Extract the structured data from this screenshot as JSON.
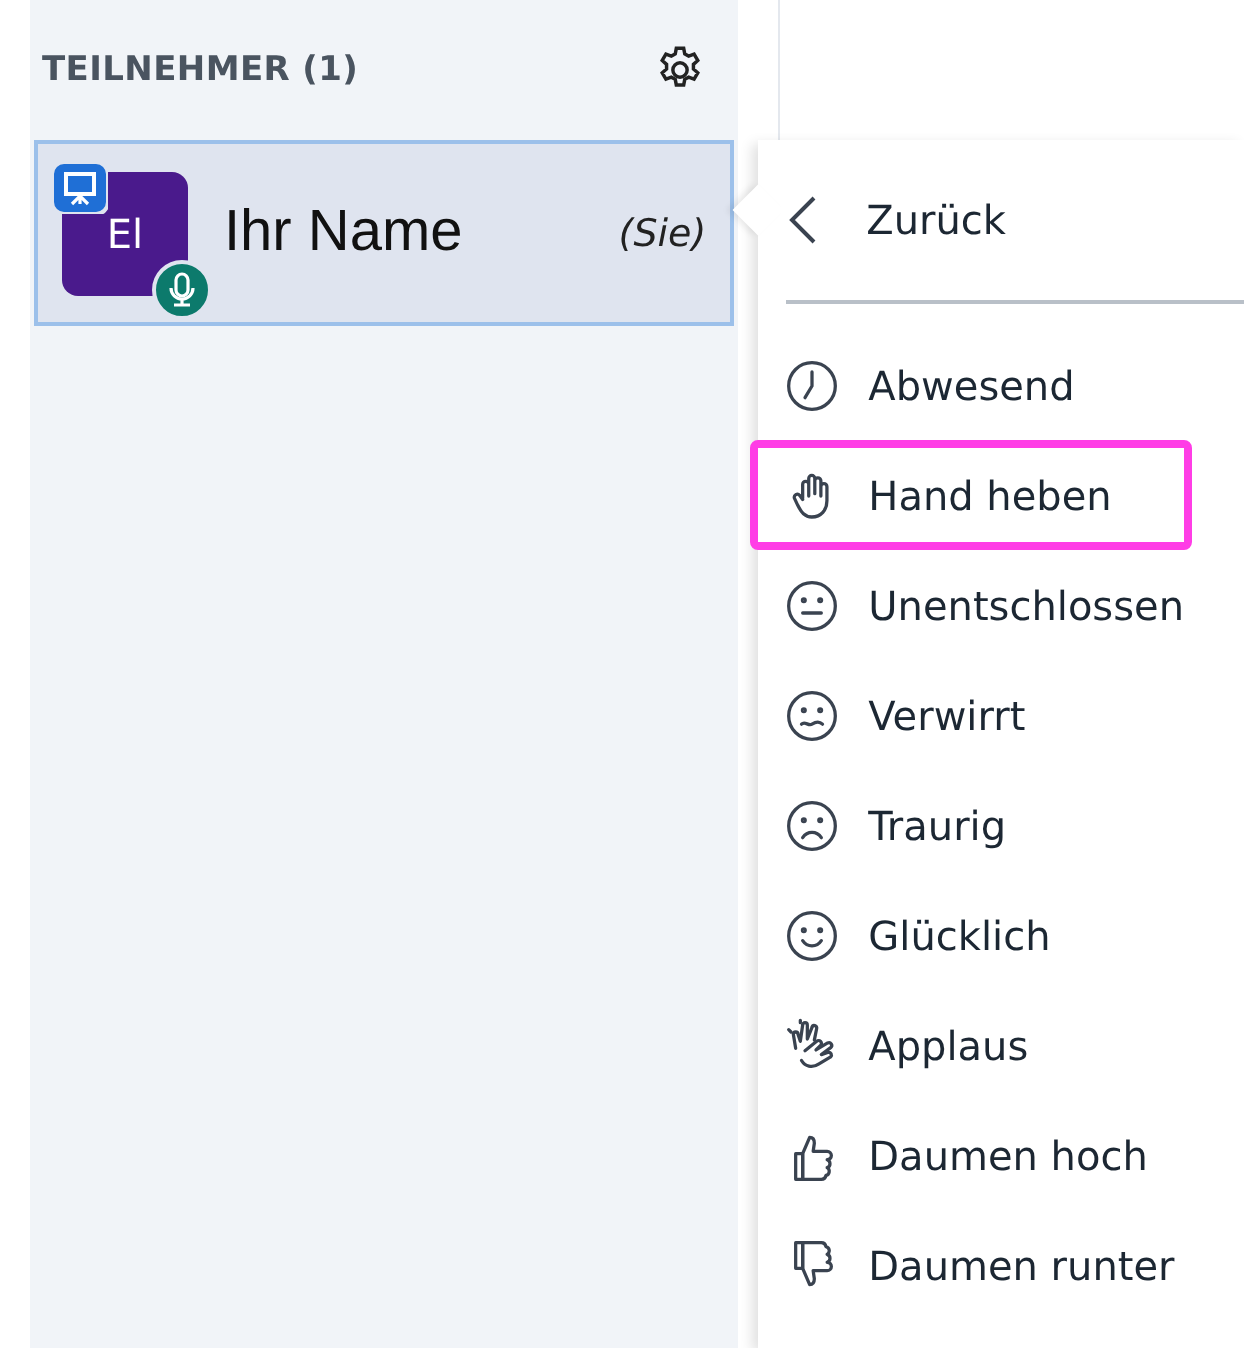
{
  "participants": {
    "title": "TEILNEHMER (1)",
    "users": [
      {
        "initials": "El",
        "name": "Ihr Name",
        "you_label": "(Sie)",
        "selected": true,
        "presenter": true,
        "mic": true
      }
    ]
  },
  "status_menu": {
    "back": "Zurück",
    "items": [
      {
        "kind": "clock",
        "label": "Abwesend",
        "highlighted": false
      },
      {
        "kind": "hand",
        "label": "Hand heben",
        "highlighted": true
      },
      {
        "kind": "neutral",
        "label": "Unentschlossen",
        "highlighted": false
      },
      {
        "kind": "confused",
        "label": "Verwirrt",
        "highlighted": false
      },
      {
        "kind": "sad",
        "label": "Traurig",
        "highlighted": false
      },
      {
        "kind": "happy",
        "label": "Glücklich",
        "highlighted": false
      },
      {
        "kind": "applause",
        "label": "Applaus",
        "highlighted": false
      },
      {
        "kind": "thumbsup",
        "label": "Daumen hoch",
        "highlighted": false
      },
      {
        "kind": "thumbsdown",
        "label": "Daumen runter",
        "highlighted": false
      }
    ]
  }
}
